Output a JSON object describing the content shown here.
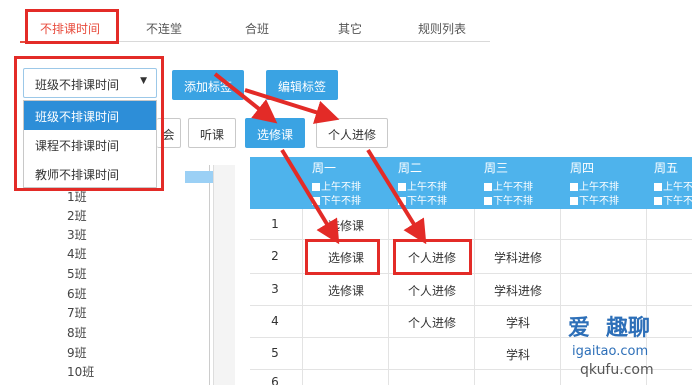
{
  "tabs": [
    {
      "label": "不排课时间",
      "active": true
    },
    {
      "label": "不连堂"
    },
    {
      "label": "合班"
    },
    {
      "label": "其它"
    },
    {
      "label": "规则列表"
    }
  ],
  "select": {
    "value": "班级不排课时间",
    "options": [
      "班级不排课时间",
      "课程不排课时间",
      "教师不排课时间"
    ],
    "caret": "▼"
  },
  "buttons": {
    "add_tag": "添加标签",
    "edit_tag": "编辑标签",
    "meeting_partial": "会",
    "lecture": "听课",
    "elective": "选修课",
    "personal_study": "个人进修"
  },
  "class_list": [
    "1班",
    "2班",
    "3班",
    "4班",
    "5班",
    "6班",
    "7班",
    "8班",
    "9班",
    "10班"
  ],
  "schedule": {
    "days": [
      "周一",
      "周二",
      "周三",
      "周四",
      "周五"
    ],
    "am_label": "上午不排",
    "pm_label": "下午不排",
    "rows": [
      {
        "num": "1",
        "cells": [
          "选修课",
          "",
          "",
          "",
          ""
        ]
      },
      {
        "num": "2",
        "cells": [
          "选修课",
          "个人进修",
          "学科进修",
          "",
          ""
        ]
      },
      {
        "num": "3",
        "cells": [
          "选修课",
          "个人进修",
          "学科进修",
          "",
          ""
        ]
      },
      {
        "num": "4",
        "cells": [
          "",
          "个人进修",
          "学科",
          "",
          ""
        ]
      },
      {
        "num": "5",
        "cells": [
          "",
          "",
          "学科",
          "",
          ""
        ]
      },
      {
        "num": "6",
        "cells": [
          "",
          "",
          "",
          "",
          ""
        ]
      }
    ]
  },
  "watermark": {
    "brand": "爱",
    "brand2": "趣聊",
    "url1": "igaitao.com",
    "url2": "qkufu.com"
  },
  "colors": {
    "accent": "#e84c3d",
    "annotation_red": "#e32b27",
    "primary_blue": "#3aa3e3",
    "header_blue": "#4eb3ec",
    "selected_blue": "#2d8ed8"
  }
}
